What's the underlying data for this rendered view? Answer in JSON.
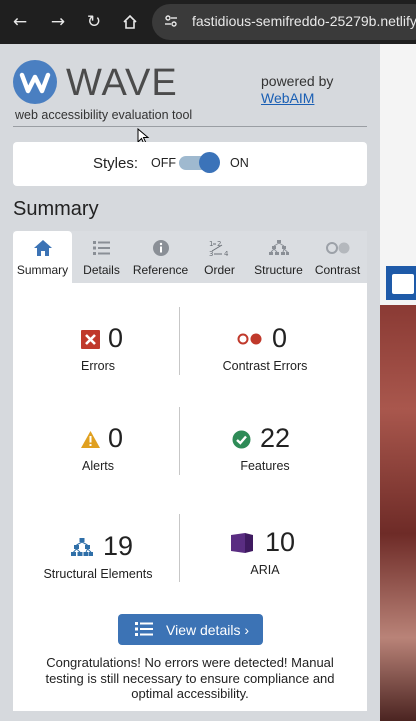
{
  "browser": {
    "url": "fastidious-semifreddo-25279b.netlify",
    "back_icon": "arrow-left-icon",
    "forward_icon": "arrow-right-icon",
    "reload_icon": "reload-icon",
    "home_icon": "home-icon"
  },
  "header": {
    "logo_word": "WAVE",
    "tagline": "web accessibility evaluation tool",
    "powered_by": "powered by",
    "webaim": "WebAIM"
  },
  "styles_toggle": {
    "label": "Styles:",
    "off": "OFF",
    "on": "ON",
    "state": "on"
  },
  "summary": {
    "heading": "Summary"
  },
  "tabs": [
    {
      "label": "Summary",
      "icon": "home-icon",
      "active": true
    },
    {
      "label": "Details",
      "icon": "list-icon",
      "active": false
    },
    {
      "label": "Reference",
      "icon": "info-icon",
      "active": false
    },
    {
      "label": "Order",
      "icon": "order-icon",
      "active": false
    },
    {
      "label": "Structure",
      "icon": "structure-icon",
      "active": false
    },
    {
      "label": "Contrast",
      "icon": "contrast-icon",
      "active": false
    }
  ],
  "stats": {
    "errors": {
      "value": "0",
      "label": "Errors"
    },
    "contrast_errors": {
      "value": "0",
      "label": "Contrast Errors"
    },
    "alerts": {
      "value": "0",
      "label": "Alerts"
    },
    "features": {
      "value": "22",
      "label": "Features"
    },
    "structural": {
      "value": "19",
      "label": "Structural Elements"
    },
    "aria": {
      "value": "10",
      "label": "ARIA"
    }
  },
  "actions": {
    "view_details": "View details ›"
  },
  "message": "Congratulations! No errors were detected! Manual testing is still necessary to ensure compliance and optimal accessibility.",
  "colors": {
    "accent": "#3c73b5",
    "error": "#c0392b",
    "alert": "#e0a020",
    "feature": "#2e8b57",
    "aria": "#5a2d82"
  }
}
